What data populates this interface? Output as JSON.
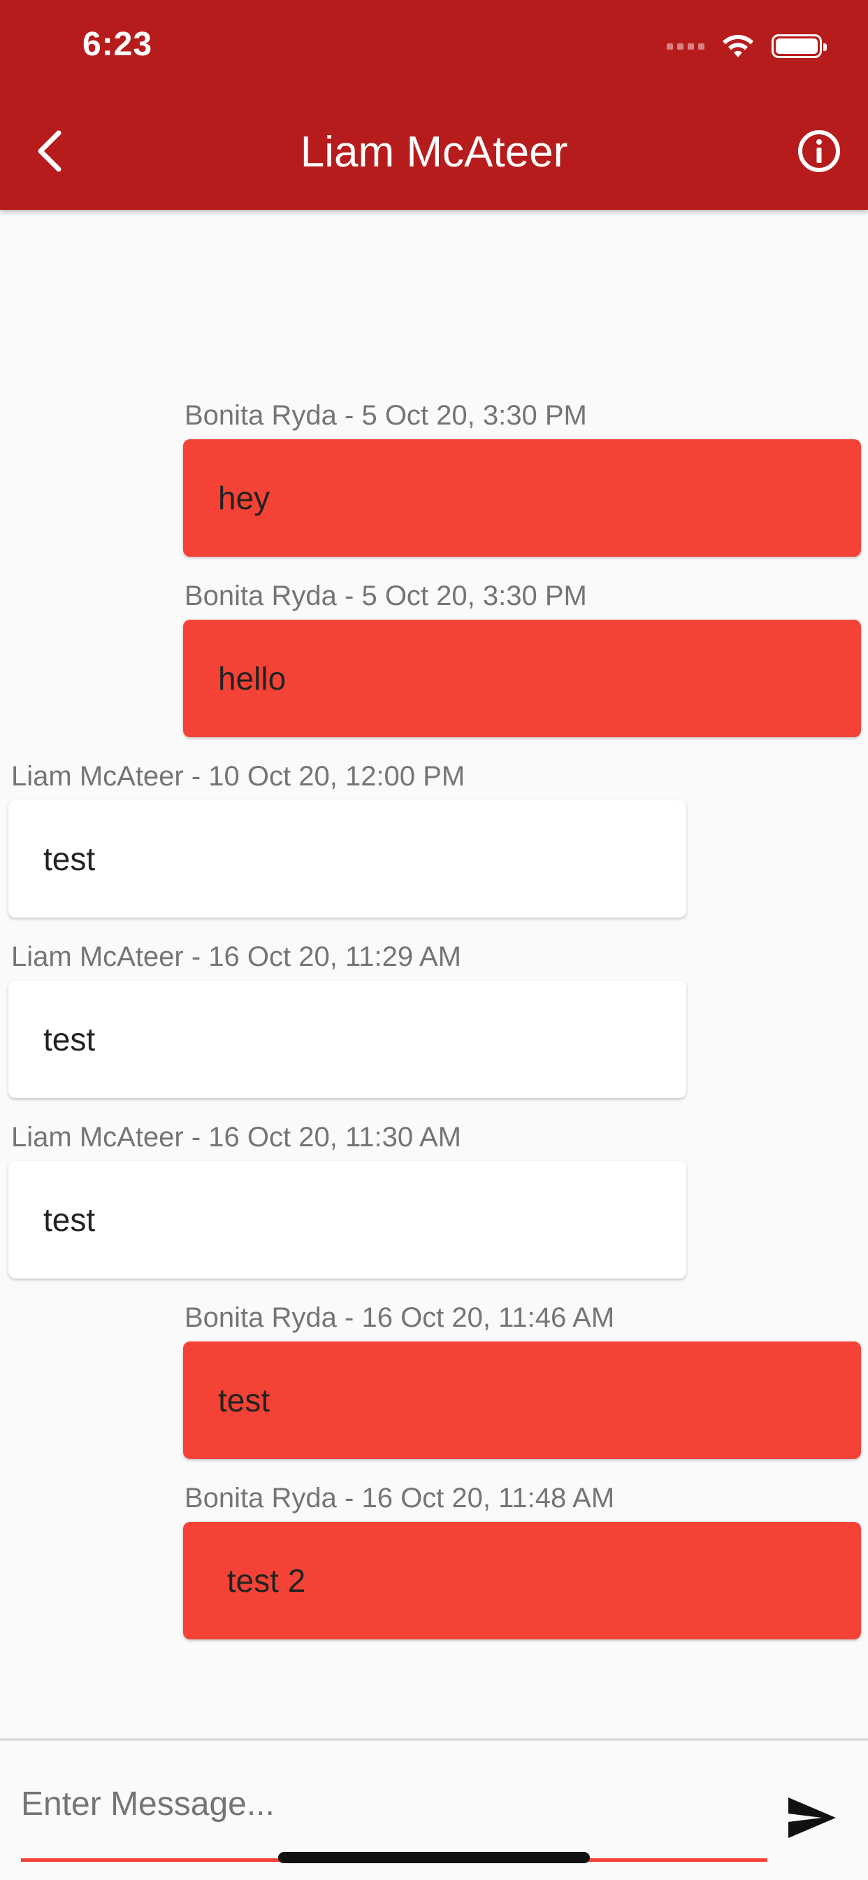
{
  "status_bar": {
    "time": "6:23"
  },
  "header": {
    "title": "Liam McAteer",
    "back_icon": "chevron-left-icon",
    "info_icon": "info-circle-icon",
    "background": "#b71c1c"
  },
  "messages": [
    {
      "meta": "Bonita Ryda - 5 Oct 20, 3:30 PM",
      "text": "hey",
      "direction": "sent"
    },
    {
      "meta": "Bonita Ryda - 5 Oct 20, 3:30 PM",
      "text": "hello",
      "direction": "sent"
    },
    {
      "meta": "Liam McAteer - 10 Oct 20, 12:00 PM",
      "text": "test",
      "direction": "received"
    },
    {
      "meta": "Liam McAteer - 16 Oct 20, 11:29 AM",
      "text": "test",
      "direction": "received"
    },
    {
      "meta": "Liam McAteer - 16 Oct 20, 11:30 AM",
      "text": "test",
      "direction": "received"
    },
    {
      "meta": "Bonita Ryda - 16 Oct 20, 11:46 AM",
      "text": "test",
      "direction": "sent"
    },
    {
      "meta": "Bonita Ryda - 16 Oct 20, 11:48 AM",
      "text": " test 2",
      "direction": "sent"
    }
  ],
  "composer": {
    "placeholder": "Enter Message...",
    "value": "",
    "send_icon": "send-icon"
  },
  "colors": {
    "sent_bubble": "#f44336",
    "received_bubble": "#ffffff",
    "accent": "#f44336"
  }
}
